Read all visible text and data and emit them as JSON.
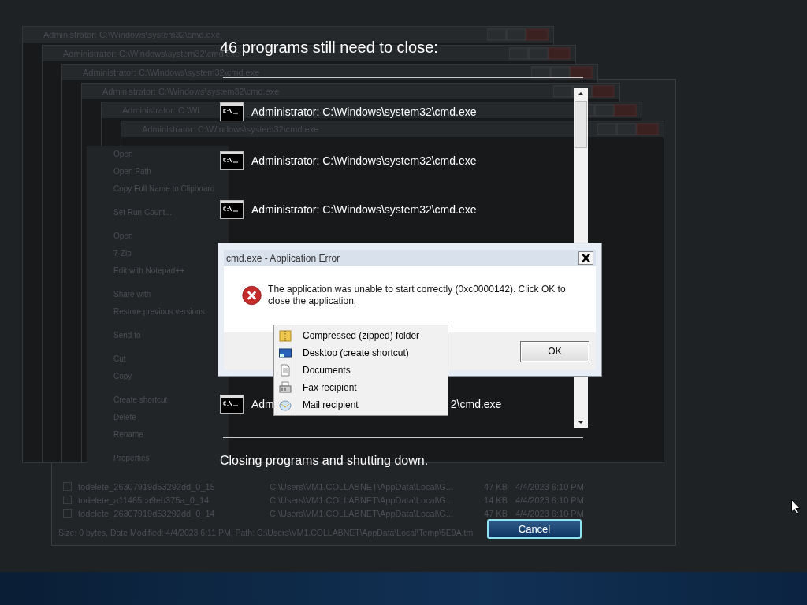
{
  "background": {
    "console_windows": [
      {
        "title": "Administrator: C:\\Windows\\system32\\cmd.exe"
      },
      {
        "title": "Administrator: C:\\Windows\\system32\\cmd.exe"
      },
      {
        "title": "Administrator: C:\\Windows\\system32\\cmd.exe"
      },
      {
        "title": "Administrator: C:\\Windows\\system32\\cmd.exe"
      },
      {
        "title": "Administrator: C:\\Wi"
      },
      {
        "title": "Administrator: C:\\Windows\\system32\\cmd.exe"
      }
    ],
    "explorer": {
      "rows": [
        {
          "checked": false,
          "name": "todelete_26307919d53292dd_0_15",
          "path": "C:\\Users\\VM1.COLLABNET\\AppData\\Local\\G...",
          "size": "47 KB",
          "date": "4/4/2023 6:10 PM"
        },
        {
          "checked": false,
          "name": "todelete_a11465ca9eb375a_0_14",
          "path": "C:\\Users\\VM1.COLLABNET\\AppData\\Local\\G...",
          "size": "14 KB",
          "date": "4/4/2023 6:10 PM"
        },
        {
          "checked": false,
          "name": "todelete_26307919d53292dd_0_14",
          "path": "C:\\Users\\VM1.COLLABNET\\AppData\\Local\\G...",
          "size": "47 KB",
          "date": "4/4/2023 6:10 PM"
        }
      ],
      "status_bar": "Size: 0 bytes, Date Modified: 4/4/2023 6:11 PM, Path: C:\\Users\\VM1.COLLABNET\\AppData\\Local\\Temp\\5E9A.tm"
    },
    "context_menu": {
      "groups": [
        [
          "Open",
          "Open Path",
          "Copy Full Name to Clipboard"
        ],
        [
          "Set Run Count..."
        ],
        [
          "Open",
          "7-Zip",
          "Edit with Notepad++"
        ],
        [
          "Share with",
          "Restore previous versions"
        ],
        [
          "Send to"
        ],
        [
          "Cut",
          "Copy"
        ],
        [
          "Create shortcut",
          "Delete",
          "Rename"
        ],
        [
          "Properties"
        ]
      ]
    }
  },
  "shutdown": {
    "heading": "46 programs still need to close:",
    "programs": [
      {
        "name": "Administrator: C:\\Windows\\system32\\cmd.exe"
      },
      {
        "name": "Administrator: C:\\Windows\\system32\\cmd.exe"
      },
      {
        "name": "Administrator: C:\\Windows\\system32\\cmd.exe"
      },
      {
        "name": "Adm",
        "tail": "2\\cmd.exe"
      }
    ],
    "status": "Closing programs and shutting down.",
    "cancel_button": "Cancel"
  },
  "error_dialog": {
    "title": "cmd.exe - Application Error",
    "message": "The application was unable to start correctly (0xc0000142). Click OK to close the application.",
    "ok_button": "OK"
  },
  "send_to_menu": {
    "items": [
      {
        "label": "Compressed (zipped) folder"
      },
      {
        "label": "Desktop (create shortcut)"
      },
      {
        "label": "Documents"
      },
      {
        "label": "Fax recipient"
      },
      {
        "label": "Mail recipient"
      }
    ]
  }
}
